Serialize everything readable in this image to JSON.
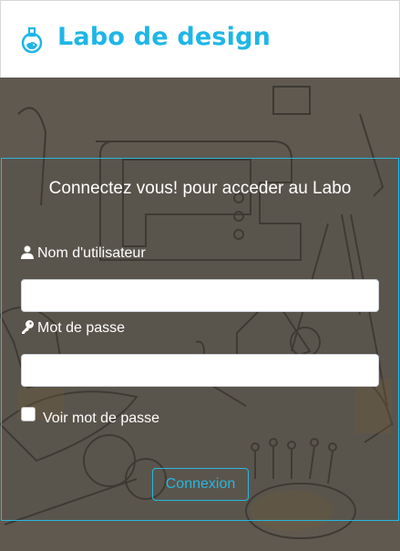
{
  "header": {
    "brand": "Labo de design",
    "logo_icon": "flask-icon",
    "brand_color": "#1fb6e6"
  },
  "form": {
    "title": "Connectez vous! pour acceder au Labo",
    "username_label": "Nom d'utilisateur",
    "username_icon": "user-icon",
    "username_value": "",
    "password_label": "Mot de passe",
    "password_icon": "key-icon",
    "password_value": "",
    "show_password_label": "Voir mot de passe",
    "show_password_checked": false,
    "submit_label": "Connexion",
    "accent_color": "#29b7df"
  }
}
